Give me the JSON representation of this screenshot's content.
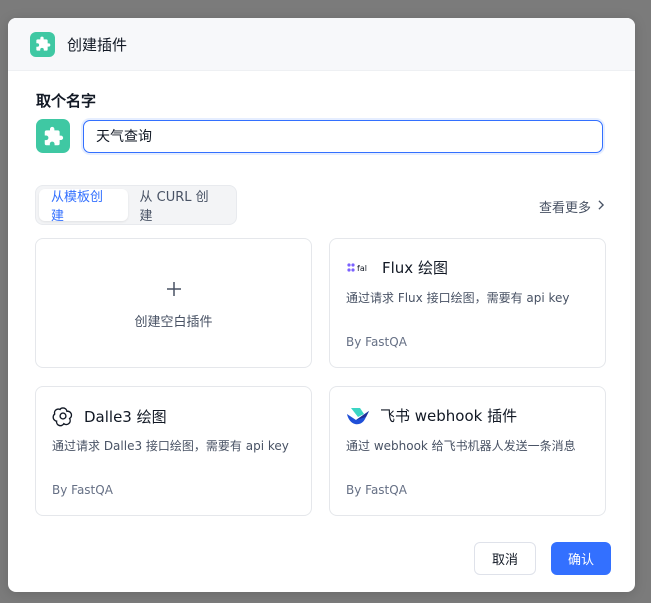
{
  "dialog": {
    "title": "创建插件",
    "name_label": "取个名字",
    "name_value": "天气查询"
  },
  "tabs": [
    {
      "label": "从模板创建",
      "active": true
    },
    {
      "label": "从 CURL 创建",
      "active": false
    }
  ],
  "more_label": "查看更多",
  "blank_card": {
    "label": "创建空白插件"
  },
  "templates": [
    {
      "title": "Flux 绘图",
      "desc": "通过请求 Flux 接口绘图，需要有 api key",
      "author": "By FastQA",
      "icon": "flux-logo-icon"
    },
    {
      "title": "Dalle3 绘图",
      "desc": "通过请求 Dalle3 接口绘图，需要有 api key",
      "author": "By FastQA",
      "icon": "openai-logo-icon"
    },
    {
      "title": "飞书 webhook 插件",
      "desc": "通过 webhook 给飞书机器人发送一条消息",
      "author": "By FastQA",
      "icon": "feishu-logo-icon"
    }
  ],
  "flux_logo_text": "fal",
  "buttons": {
    "cancel": "取消",
    "confirm": "确认"
  },
  "colors": {
    "primary": "#3370ff",
    "plugin_green": "#3fc8a3"
  }
}
